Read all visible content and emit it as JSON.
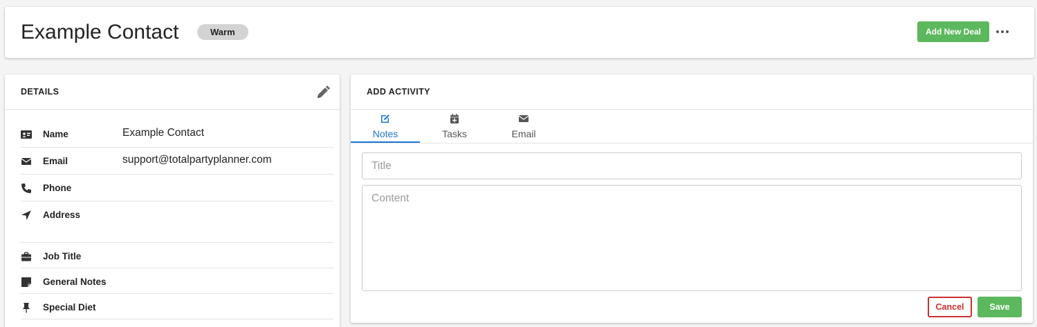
{
  "header": {
    "title": "Example Contact",
    "badge": "Warm",
    "add_deal_label": "Add New Deal",
    "more_icon": "ellipsis-icon"
  },
  "details": {
    "title": "DETAILS",
    "edit_icon": "pencil-icon",
    "rows": [
      {
        "icon": "id-card-icon",
        "label": "Name",
        "value": "Example Contact"
      },
      {
        "icon": "envelope-icon",
        "label": "Email",
        "value": "support@totalpartyplanner.com"
      },
      {
        "icon": "phone-icon",
        "label": "Phone",
        "value": ""
      },
      {
        "icon": "location-arrow-icon",
        "label": "Address",
        "value": ""
      },
      {
        "icon": "briefcase-icon",
        "label": "Job Title",
        "value": ""
      },
      {
        "icon": "sticky-note-icon",
        "label": "General Notes",
        "value": ""
      },
      {
        "icon": "thumbtack-icon",
        "label": "Special Diet",
        "value": ""
      }
    ]
  },
  "activity": {
    "title": "ADD ACTIVITY",
    "tabs": [
      {
        "label": "Notes",
        "icon": "edit-icon",
        "active": true
      },
      {
        "label": "Tasks",
        "icon": "calendar-plus-icon",
        "active": false
      },
      {
        "label": "Email",
        "icon": "envelope-icon",
        "active": false
      }
    ],
    "title_placeholder": "Title",
    "content_placeholder": "Content",
    "cancel_label": "Cancel",
    "save_label": "Save"
  },
  "colors": {
    "green": "#5cb85c",
    "red": "#c9302c",
    "blue": "#1976d2",
    "badge_bg": "#d3d3d3"
  }
}
